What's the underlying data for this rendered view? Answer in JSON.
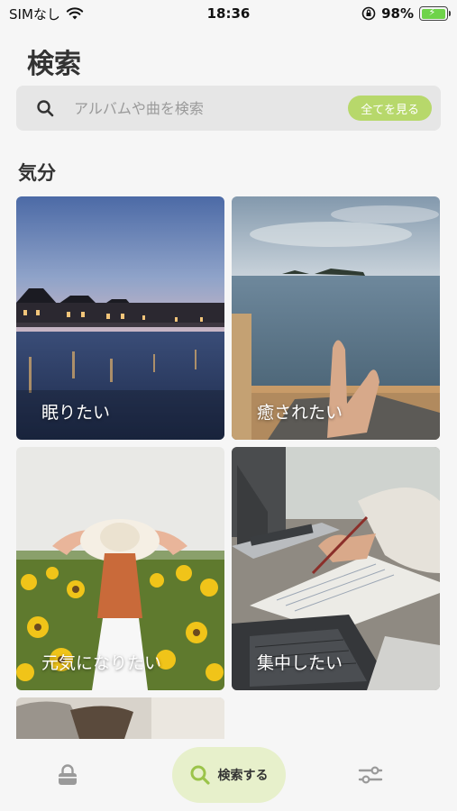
{
  "status_bar": {
    "carrier": "SIMなし",
    "time": "18:36",
    "battery_percent": "98%",
    "battery_level": 0.98,
    "icons": [
      "wifi-icon",
      "orientation-lock-icon",
      "battery-icon"
    ]
  },
  "header": {
    "title": "検索"
  },
  "search": {
    "placeholder": "アルバムや曲を検索",
    "value": "",
    "see_all_label": "全てを見る"
  },
  "mood_section": {
    "title": "気分",
    "cards": [
      {
        "label": "眠りたい"
      },
      {
        "label": "癒されたい"
      },
      {
        "label": "元気になりたい"
      },
      {
        "label": "集中したい"
      }
    ]
  },
  "tab_bar": {
    "items": [
      {
        "icon": "lock-icon"
      },
      {
        "icon": "search-icon",
        "label": "検索する",
        "active": true
      },
      {
        "icon": "settings-sliders-icon"
      }
    ]
  },
  "colors": {
    "accent": "#b7d86b",
    "active_tab_bg": "#e7f0cb",
    "background": "#f6f6f6",
    "search_bg": "#e6e6e6"
  }
}
